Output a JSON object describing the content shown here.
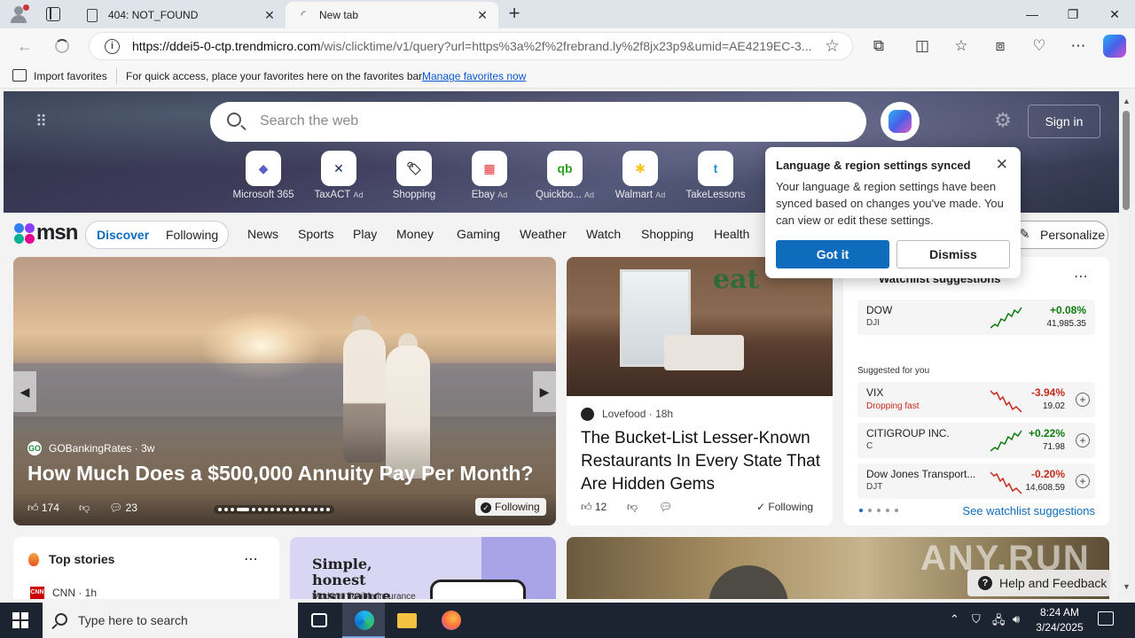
{
  "browser": {
    "tabs": [
      {
        "title": "404: NOT_FOUND",
        "active": false
      },
      {
        "title": "New tab",
        "active": true
      }
    ],
    "url_host": "https://ddei5-0-ctp.trendmicro.com",
    "url_rest": "/wis/clicktime/v1/query?url=https%3a%2f%2frebrand.ly%2f8jx23p9&umid=AE4219EC-3...",
    "favorites_bar": {
      "import_label": "Import favorites",
      "message": "For quick access, place your favorites here on the favorites bar.",
      "manage_link": "Manage favorites now"
    }
  },
  "msn": {
    "search_placeholder": "Search the web",
    "sign_in": "Sign in",
    "shortcuts": [
      {
        "label": "Microsoft 365",
        "ad": "",
        "glyph": "◆",
        "color": "#5b5fc7"
      },
      {
        "label": "TaxACT",
        "ad": "Ad",
        "glyph": "✕",
        "color": "#1a2b4a"
      },
      {
        "label": "Shopping",
        "ad": "",
        "glyph": "🏷",
        "color": "#333333"
      },
      {
        "label": "Ebay",
        "ad": "Ad",
        "glyph": "▦",
        "color": "#e53238"
      },
      {
        "label": "Quickbo...",
        "ad": "Ad",
        "glyph": "qb",
        "color": "#2ca01c"
      },
      {
        "label": "Walmart",
        "ad": "Ad",
        "glyph": "✱",
        "color": "#ffc220"
      },
      {
        "label": "TakeLessons",
        "ad": "",
        "glyph": "t",
        "color": "#1d8fd1"
      }
    ],
    "logo_text": "msn",
    "tabs": {
      "discover": "Discover",
      "following": "Following"
    },
    "categories": [
      "News",
      "Sports",
      "Play",
      "Money",
      "Gaming",
      "Weather",
      "Watch",
      "Shopping",
      "Health"
    ],
    "personalize": "Personalize"
  },
  "hero_card": {
    "source": "GOBankingRates",
    "age": "3w",
    "headline": "How Much Does a $500,000 Annuity Pay Per Month?",
    "likes": "174",
    "comments": "23",
    "follow": "Following"
  },
  "food_card": {
    "source": "Lovefood",
    "age": "18h",
    "headline": "The Bucket-List Lesser-Known Restaurants In Every State That Are Hidden Gems",
    "likes": "12",
    "follow": "Following"
  },
  "watchlist": {
    "title": "Watchlist suggestions",
    "suggested_label": "Suggested for you",
    "see_all": "See watchlist suggestions",
    "stocks": [
      {
        "name": "DOW",
        "ticker": "DJI",
        "note": "",
        "change": "+0.08%",
        "price": "41,985.35",
        "dir": "up",
        "color": "#107c10"
      },
      {
        "name": "VIX",
        "ticker": "",
        "note": "Dropping fast",
        "change": "-3.94%",
        "price": "19.02",
        "dir": "down",
        "color": "#c42b1c"
      },
      {
        "name": "CITIGROUP INC.",
        "ticker": "C",
        "note": "",
        "change": "+0.22%",
        "price": "71.98",
        "dir": "up",
        "color": "#107c10"
      },
      {
        "name": "Dow Jones Transport...",
        "ticker": "DJT",
        "note": "",
        "change": "-0.20%",
        "price": "14,608.59",
        "dir": "down",
        "color": "#c42b1c"
      }
    ]
  },
  "top_stories": {
    "title": "Top stories",
    "source": "CNN · 1h"
  },
  "insurance_ad": {
    "headline": "Simple, honest insurance",
    "sub": "Modern, flexible insurance"
  },
  "popup": {
    "title": "Language & region settings synced",
    "body": "Your language & region settings have been synced based on changes you've made. You can view or edit these settings.",
    "primary": "Got it",
    "secondary": "Dismiss"
  },
  "watermark": "ANY.RUN",
  "help": "Help and Feedback",
  "taskbar": {
    "search_placeholder": "Type here to search",
    "time": "8:24 AM",
    "date": "3/24/2025"
  }
}
